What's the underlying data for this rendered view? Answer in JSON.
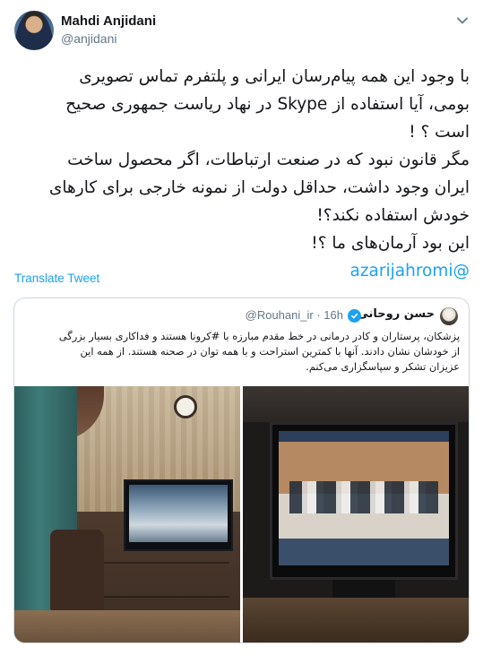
{
  "tweet": {
    "author": {
      "name": "Mahdi Anjidani",
      "handle": "@anjidani",
      "avatar_icon": "profile-photo"
    },
    "text_lines": [
      "با وجود این همه پیام‌رسان ایرانی و پلتفرم تماس تصویری",
      "بومی، آیا استفاده از Skype در نهاد ریاست جمهوری صحیح",
      "است ؟ !",
      "مگر قانون نبود که در صنعت ارتباطات، اگر محصول ساخت",
      "ایران وجود داشت، حداقل دولت از نمونه خارجی برای کارهای",
      "خودش استفاده نکند؟!",
      "این بود آرمان‌های ما ؟!"
    ],
    "mention": "@azarijahromi",
    "translate_label": "Translate Tweet",
    "more_icon": "chevron-down-icon",
    "colors": {
      "link": "#1da1f2",
      "text": "#14171a",
      "muted": "#657786",
      "border": "#ccd6dd"
    }
  },
  "quote": {
    "author": {
      "name": "حسن روحانی",
      "handle": "@Rouhani_ir",
      "time": "16h",
      "verified_icon": "verified-badge-icon"
    },
    "text_lines": [
      "پزشکان، پرستاران و کادر درمانی در خط مقدم مبارزه با #کرونا هستند و فداکاری بسیار بزرگی",
      "از خودشان نشان دادند. آنها با کمترین استراحت و با همه توان در صحنه هستند. از همه این",
      "عزیزان تشکر و سپاسگزاری می‌کنم."
    ],
    "separator": "·",
    "media": [
      {
        "alt_name": "office-room-video-call-photo"
      },
      {
        "alt_name": "monitor-video-call-photo"
      }
    ]
  }
}
